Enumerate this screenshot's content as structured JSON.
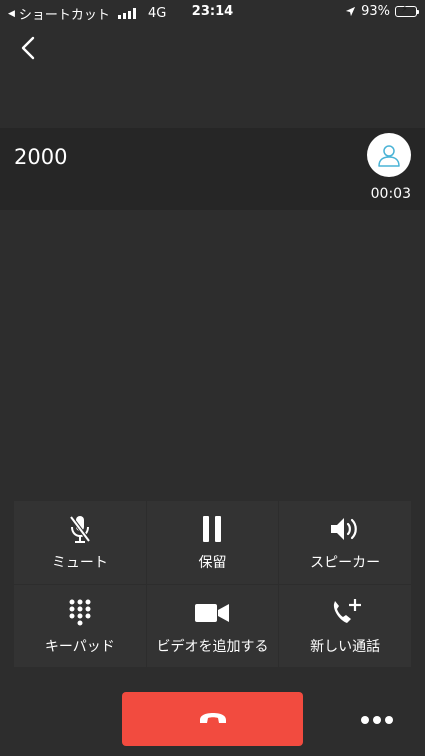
{
  "status_bar": {
    "back_app": "ショートカット",
    "network": "4G",
    "time": "23:14",
    "battery": "93%"
  },
  "caller": {
    "number": "2000",
    "duration": "00:03"
  },
  "controls": {
    "mute": "ミュート",
    "hold": "保留",
    "speaker": "スピーカー",
    "keypad": "キーパッド",
    "add_video": "ビデオを追加する",
    "new_call": "新しい通話"
  },
  "icons": {
    "back": "chevron-left-icon",
    "avatar": "user-icon",
    "mute": "microphone-off-icon",
    "hold": "pause-icon",
    "speaker": "speaker-icon",
    "keypad": "keypad-icon",
    "video": "video-camera-icon",
    "new_call": "phone-plus-icon",
    "hangup": "phone-hangup-icon",
    "more": "more-dots-icon"
  },
  "colors": {
    "background": "#2d2d2d",
    "panel": "#262626",
    "button": "#333333",
    "hangup": "#f24b3f",
    "battery": "#4cd964",
    "avatar_outline": "#4ab3d6"
  }
}
